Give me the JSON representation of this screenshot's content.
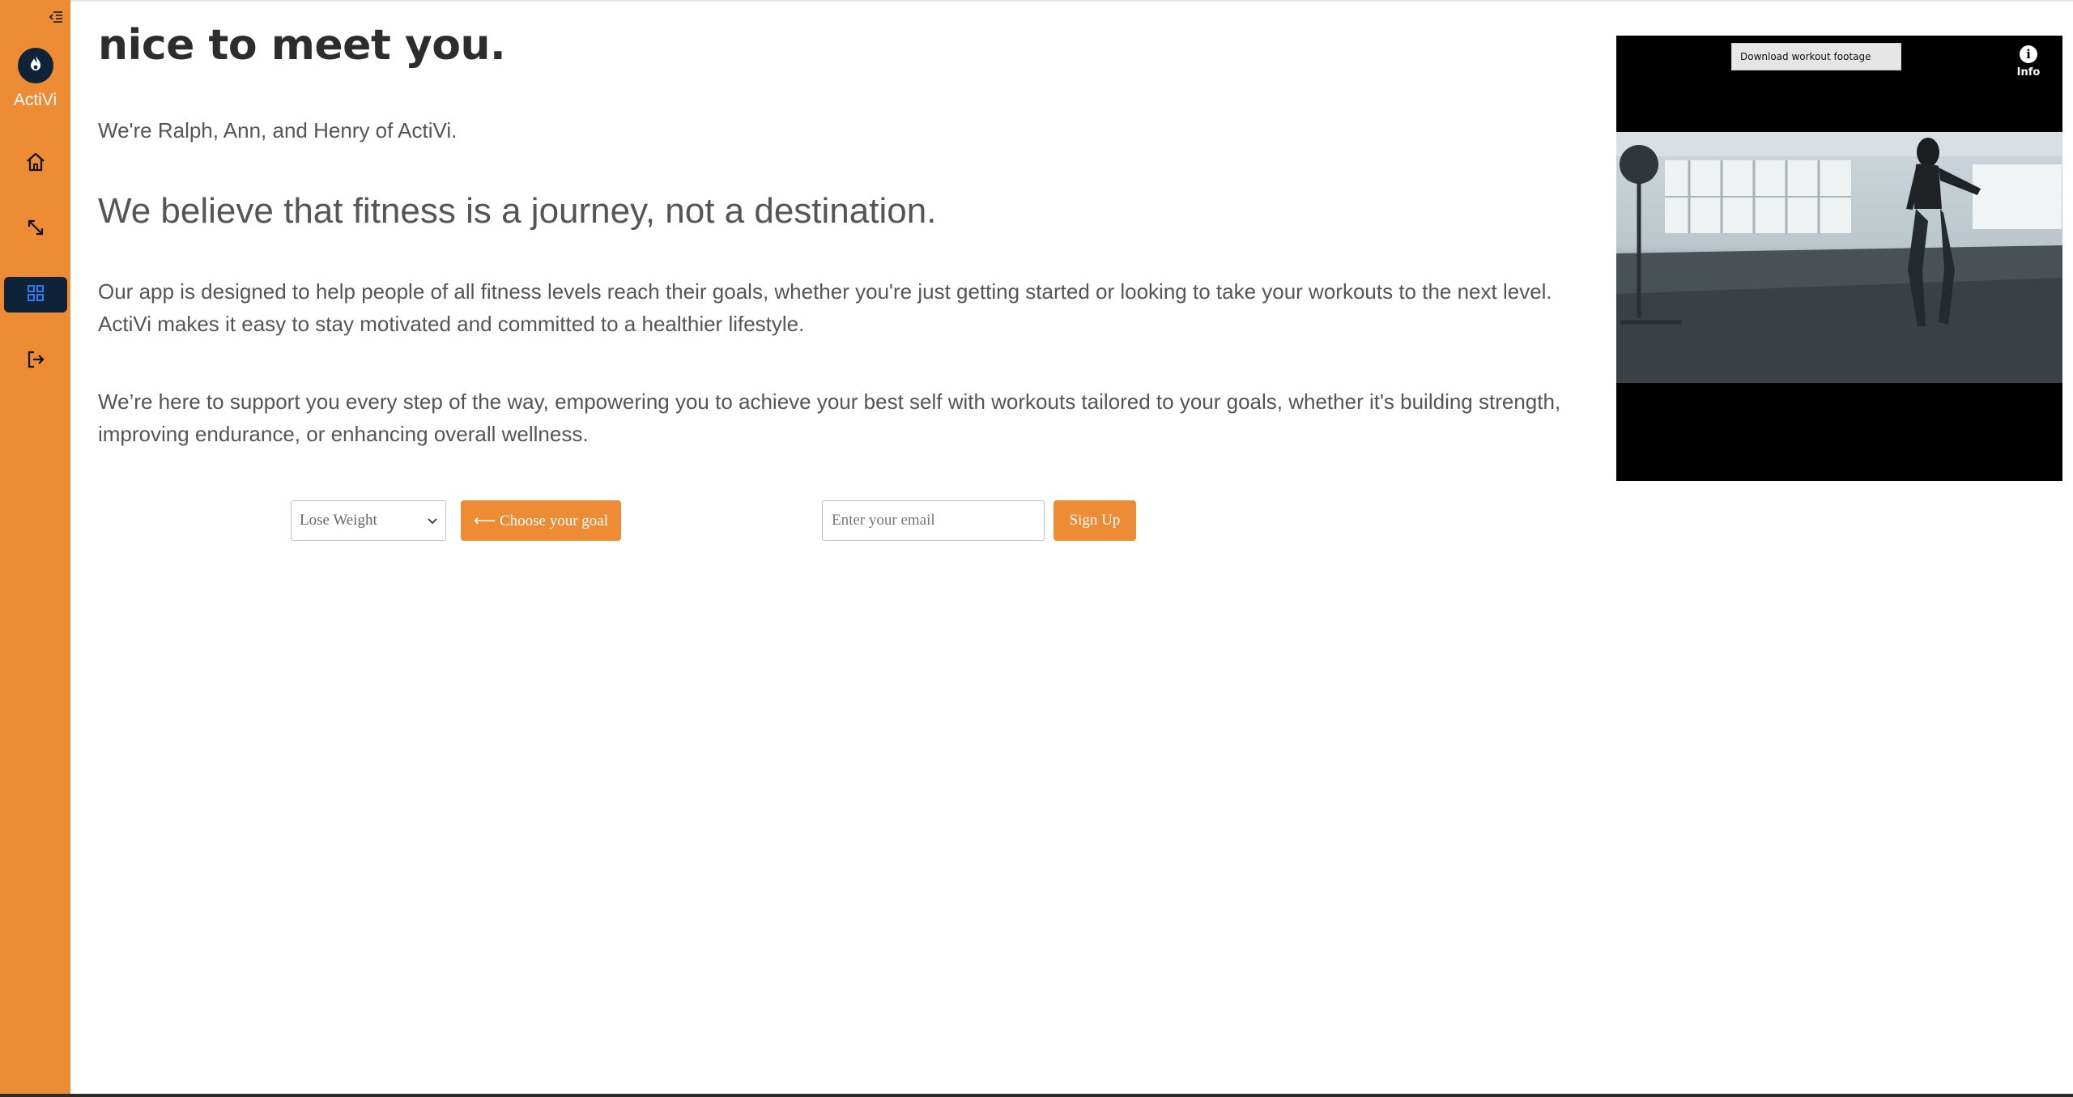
{
  "sidebar": {
    "brand": "ActiVi",
    "items": [
      {
        "name": "home",
        "icon": "home-icon"
      },
      {
        "name": "expand",
        "icon": "expand-arrows-icon"
      },
      {
        "name": "dashboard",
        "icon": "grid-icon",
        "active": true
      },
      {
        "name": "logout",
        "icon": "logout-icon"
      }
    ],
    "accent": "#ed8c34",
    "active_bg": "#0e2338",
    "active_icon_color": "#2d7df6"
  },
  "main": {
    "headline": "nice to meet you.",
    "intro": "We're Ralph, Ann, and Henry of ActiVi.",
    "belief": "We believe that fitness is a journey, not a destination.",
    "paragraph1": "Our app is designed to help people of all fitness levels reach their goals, whether you're just getting started or looking to take your workouts to the next level. ActiVi makes it easy to stay motivated and committed to a healthier lifestyle.",
    "paragraph2": "We’re here to support you every step of the way, empowering you to achieve your best self with workouts tailored to your goals, whether it's building strength, improving endurance, or enhancing overall wellness."
  },
  "form": {
    "goal_selected": "Lose Weight",
    "choose_label": "⟵ Choose your goal",
    "email_placeholder": "Enter your email",
    "signup_label": "Sign Up"
  },
  "video": {
    "download_label": "Download workout footage",
    "info_label": "Info"
  }
}
